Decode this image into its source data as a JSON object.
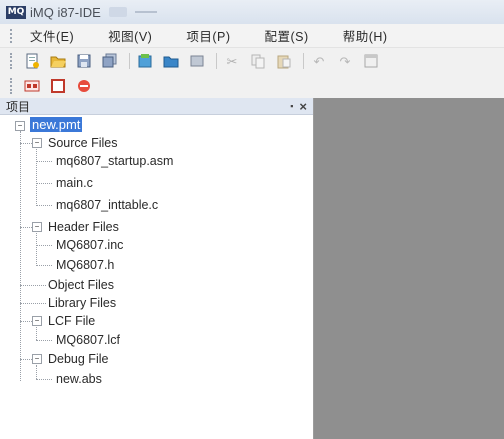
{
  "window": {
    "title": "iMQ i87-IDE",
    "app_icon_text": "MQ"
  },
  "menu": [
    "文件(E)",
    "视图(V)",
    "项目(P)",
    "配置(S)",
    "帮助(H)"
  ],
  "toolbar": {
    "row1_icons": [
      "new-file-icon",
      "open-folder-icon",
      "save-icon",
      "save-all-icon",
      "new-project-icon",
      "open-project-icon",
      "close-project-icon",
      "cut-icon",
      "copy-icon",
      "paste-icon",
      "undo-icon",
      "redo-icon",
      "window-icon"
    ],
    "row2_icons": [
      "compile-icon",
      "build-icon",
      "stop-icon"
    ]
  },
  "panel": {
    "title": "项目",
    "pin": "▪",
    "close": "×"
  },
  "tree": {
    "root": "new.pmt",
    "source_files": {
      "label": "Source Files",
      "items": [
        "mq6807_startup.asm",
        "main.c",
        "mq6807_inttable.c"
      ]
    },
    "header_files": {
      "label": "Header Files",
      "items": [
        "MQ6807.inc",
        "MQ6807.h"
      ]
    },
    "object_files": {
      "label": "Object Files"
    },
    "library_files": {
      "label": "Library Files"
    },
    "lcf_file": {
      "label": "LCF File",
      "items": [
        "MQ6807.lcf"
      ]
    },
    "debug_file": {
      "label": "Debug File",
      "items": [
        "new.abs"
      ]
    },
    "expander_open": "−"
  },
  "colors": {
    "selection": "#3b78d8",
    "workspace": "#8f8f8f",
    "panel_header": "#dfe6f1"
  }
}
